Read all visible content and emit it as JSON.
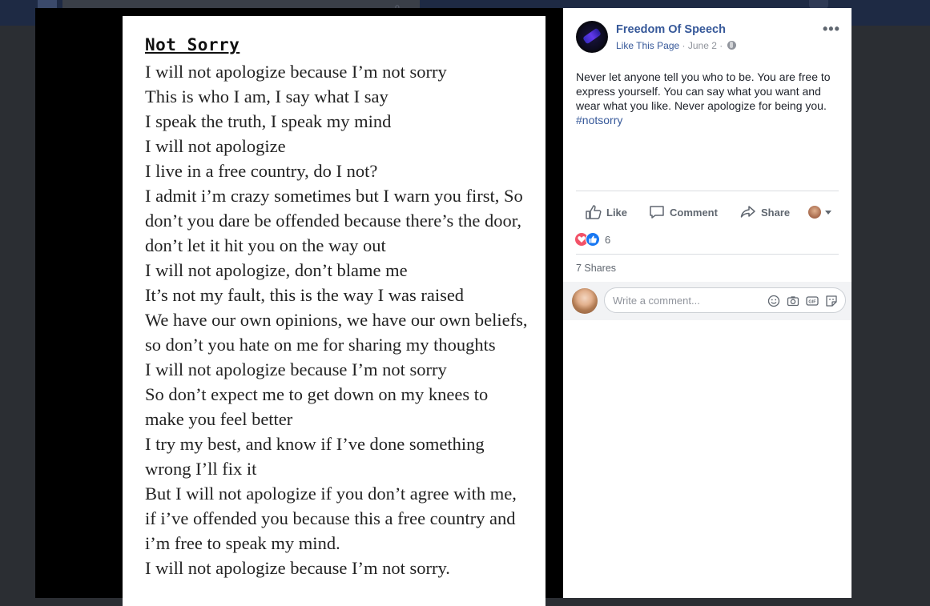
{
  "poem": {
    "title": "Not Sorry",
    "lines": [
      "I will not apologize because I’m not sorry",
      "This is who I am, I say what I say",
      "I speak the truth, I speak my mind",
      "I will not apologize",
      "I live in a free country, do I not?",
      "I admit i’m crazy sometimes but I warn you first, So",
      "don’t you dare be offended because there’s the door,",
      "don’t let it hit you on the way out",
      "I will not apologize, don’t blame me",
      "It’s not my fault, this is the way I was raised",
      "We have our own opinions, we have our own beliefs,",
      "so don’t you hate on me for sharing my thoughts",
      "I will not apologize because I’m not sorry",
      "So don’t expect me to get down on my knees to",
      "make you feel better",
      "I try my best, and know if  I’ve done something",
      "wrong I’ll fix it",
      "But I will not apologize if  you don’t agree with me,",
      "if i’ve offended you because this a free country and",
      "i’m free to speak my mind.",
      "I will not apologize because I’m not sorry."
    ]
  },
  "post": {
    "page_name": "Freedom Of Speech",
    "like_page": "Like This Page",
    "date": "June 2",
    "separator": "·",
    "text": "Never let anyone tell you who to be. You are free to express yourself. You can say what you want and wear what you like. Never apologize for being you. ",
    "hashtag": "#notsorry",
    "more_icon": "ellipsis-icon",
    "visibility_icon": "globe-icon"
  },
  "actions": {
    "like": "Like",
    "comment": "Comment",
    "share": "Share"
  },
  "reactions": {
    "count": "6",
    "types": [
      "love",
      "like"
    ]
  },
  "shares": "7 Shares",
  "comment_input": {
    "placeholder": "Write a comment...",
    "icons": [
      "emoji-icon",
      "camera-icon",
      "gif-icon",
      "sticker-icon"
    ]
  },
  "colors": {
    "link": "#365899",
    "love": "#f25268",
    "like": "#1877f2"
  }
}
